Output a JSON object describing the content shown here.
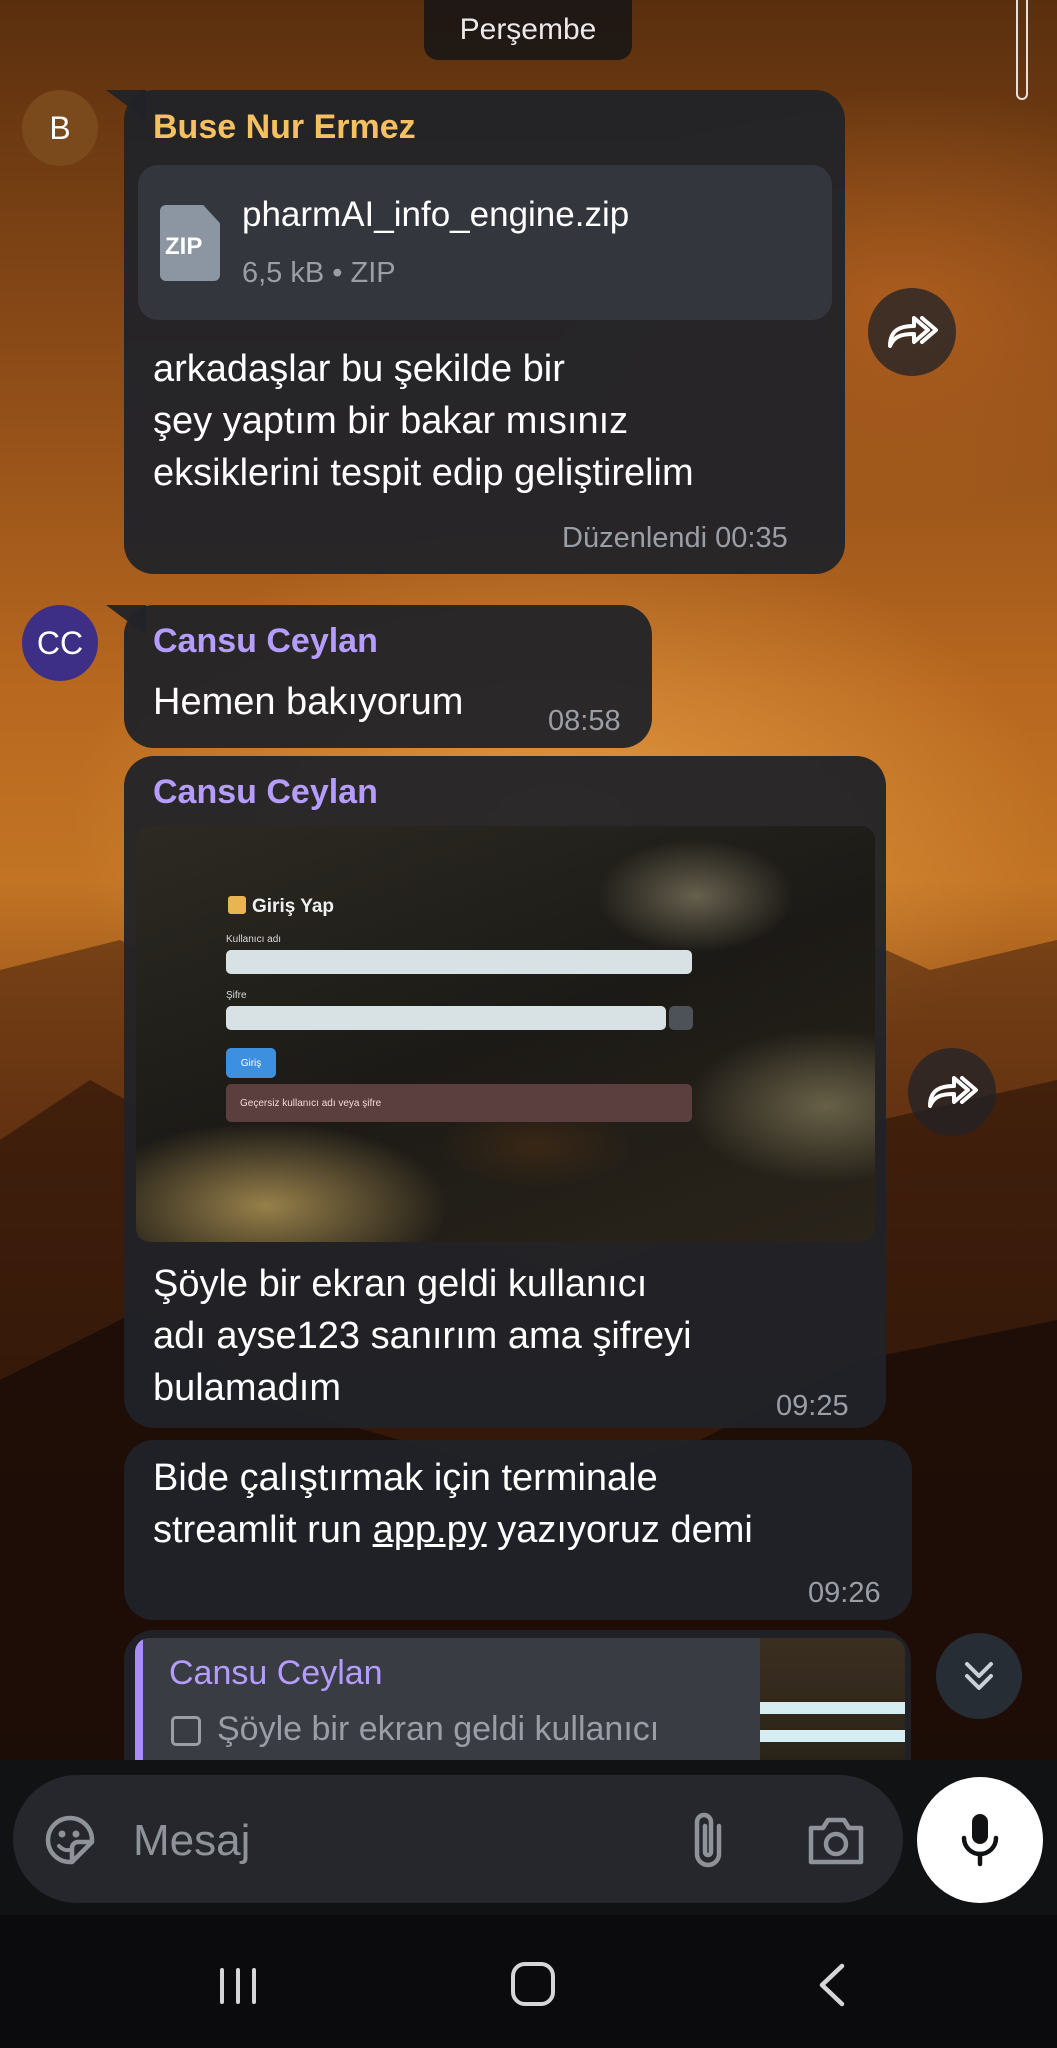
{
  "date_chip": "Perşembe",
  "messages": [
    {
      "avatar_initials": "B",
      "sender": "Buse Nur Ermez",
      "file": {
        "name": "pharmAI_info_engine.zip",
        "meta": "6,5 kB • ZIP",
        "icon_label": "ZIP"
      },
      "lines": [
        "arkadaşlar bu şekilde bir",
        "şey yaptım bir bakar mısınız",
        "eksiklerini tespit edip geliştirelim"
      ],
      "meta": "Düzenlendi 00:35"
    },
    {
      "avatar_initials": "CC",
      "sender": "Cansu Ceylan",
      "text": "Hemen bakıyorum",
      "time": "08:58"
    },
    {
      "sender": "Cansu Ceylan",
      "photo": {
        "title": "Giriş Yap",
        "username_label": "Kullanıcı adı",
        "password_label": "Şifre",
        "login_button": "Giriş",
        "error_text": "Geçersiz kullanıcı adı veya şifre"
      },
      "lines": [
        "Şöyle bir ekran geldi kullanıcı",
        "adı ayse123 sanırım ama şifreyi",
        "bulamadım"
      ],
      "time": "09:25"
    },
    {
      "line1": "Bide çalıştırmak için terminale",
      "line2_pre": "streamlit run ",
      "line2_link": "app.py",
      "line2_post": " yazıyoruz demi",
      "time": "09:26"
    }
  ],
  "reply_preview": {
    "sender": "Cansu Ceylan",
    "text": "Şöyle bir ekran geldi kullanıcı"
  },
  "input": {
    "placeholder": "Mesaj"
  },
  "colors": {
    "sender_orange": "#f4c062",
    "sender_purple": "#b59cff",
    "bubble": "#212328"
  }
}
